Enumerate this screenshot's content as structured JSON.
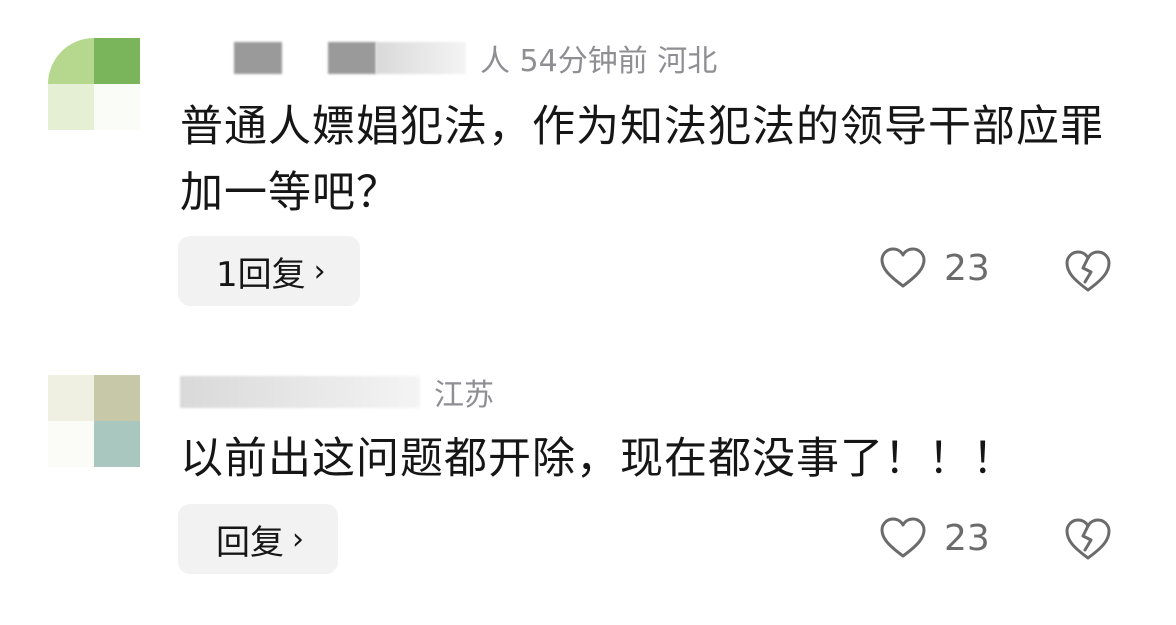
{
  "comments": [
    {
      "meta_suffix": "人  54分钟前  河北",
      "text": "普通人嫖娼犯法，作为知法犯法的领导干部应罪加一等吧？",
      "reply_label": "1回复",
      "reply_chevron": "›",
      "like_count": "23"
    },
    {
      "meta_suffix": "江苏",
      "text": "以前出这问题都开除，现在都没事了！！！",
      "reply_label": "回复",
      "reply_chevron": "›",
      "like_count": "23"
    }
  ],
  "icons": {
    "like": "heart-outline-icon",
    "dislike": "broken-heart-icon",
    "chevron": "chevron-right-icon"
  },
  "colors": {
    "text_primary": "#161616",
    "text_secondary": "#8e8e93",
    "button_bg": "#f2f2f2"
  }
}
